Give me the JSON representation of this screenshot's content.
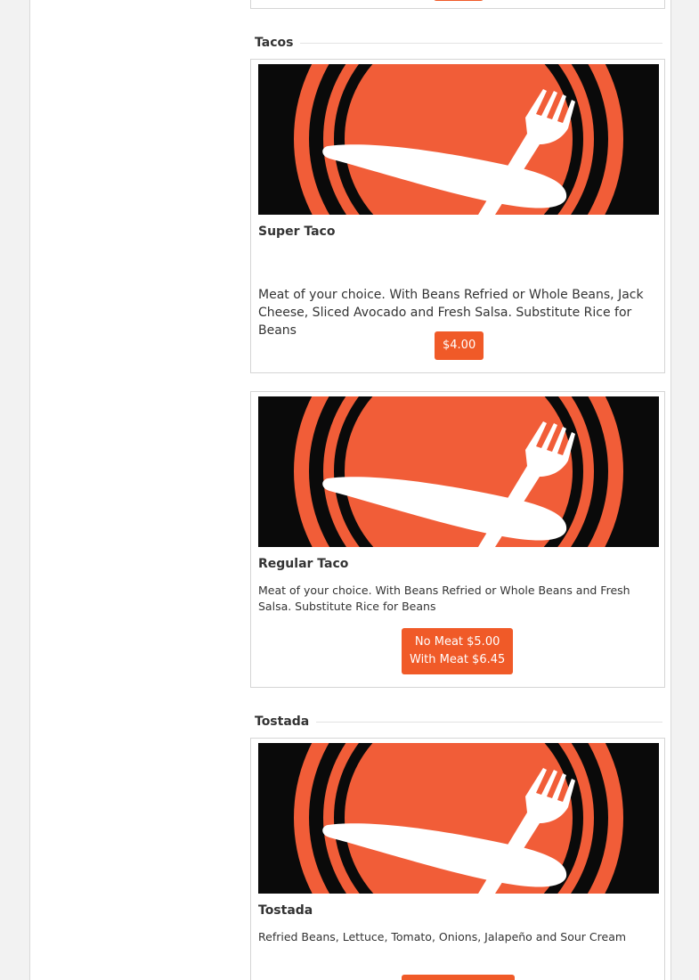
{
  "sections": {
    "tacos": {
      "title": "Tacos"
    },
    "tostada": {
      "title": "Tostada"
    }
  },
  "items": [
    {
      "name": "Super Taco",
      "description": "Meat of your choice. With Beans Refried or Whole Beans, Jack Cheese, Sliced Avocado and Fresh Salsa. Substitute Rice for Beans",
      "prices": [
        "$4.00"
      ]
    },
    {
      "name": "Regular Taco",
      "description": "Meat of your choice. With Beans Refried or Whole Beans and Fresh Salsa. Substitute Rice for Beans",
      "prices": [
        "No Meat $5.00",
        "With Meat $6.45"
      ]
    },
    {
      "name": "Tostada",
      "description": "Refried Beans, Lettuce, Tomato, Onions, Jalapeño and Sour Cream",
      "prices": []
    }
  ],
  "colors": {
    "accent": "#f05a28",
    "logo_orange": "#f15d38",
    "logo_black": "#0a0a0a"
  },
  "icons": {
    "item_image": "plate-fork-knife-icon"
  }
}
